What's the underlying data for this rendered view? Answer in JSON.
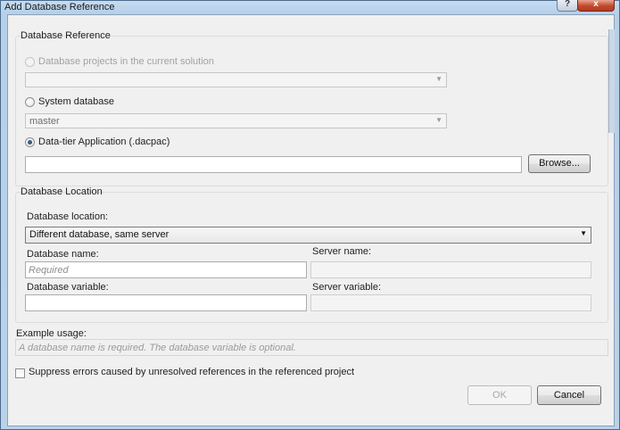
{
  "window": {
    "title": "Add Database Reference",
    "help_glyph": "?",
    "close_glyph": "x"
  },
  "reference": {
    "group_label": "Database Reference",
    "option_projects": "Database projects in the current solution",
    "projects_combo_value": "",
    "option_system": "System database",
    "system_combo_value": "master",
    "option_dacpac": "Data-tier Application (.dacpac)",
    "dacpac_path": "",
    "browse_label": "Browse..."
  },
  "location": {
    "group_label": "Database Location",
    "location_label": "Database location:",
    "location_value": "Different database, same server",
    "db_name_label": "Database name:",
    "db_name_placeholder": "Required",
    "server_name_label": "Server name:",
    "db_variable_label": "Database variable:",
    "server_variable_label": "Server variable:"
  },
  "example": {
    "label": "Example usage:",
    "text": "A database name is required.  The database variable is optional."
  },
  "suppress": {
    "label": "Suppress errors caused by unresolved references in the referenced project",
    "checked": false
  },
  "buttons": {
    "ok": "OK",
    "cancel": "Cancel"
  },
  "icons": {
    "combo_arrow": "▼"
  }
}
